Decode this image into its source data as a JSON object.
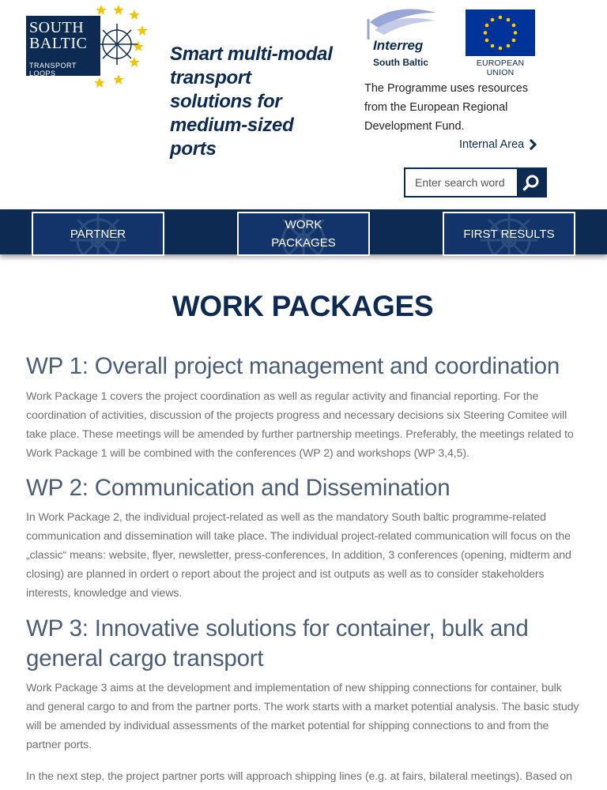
{
  "header": {
    "logo": {
      "line1": "SOUTH",
      "line2": "BALTIC",
      "line3": "TRANSPORT LOOPS"
    },
    "tagline": "Smart multi-modal transport solutions for medium-sized ports",
    "interreg": {
      "word": "Interreg",
      "sub": "South Baltic"
    },
    "eu_label": "EUROPEAN UNION",
    "funding_text": "The Programme uses resources from the European Regional Development Fund.",
    "internal_area": "Internal Area",
    "search": {
      "placeholder": "Enter search word",
      "value": ""
    },
    "brand_color": "#0c2a52"
  },
  "nav": {
    "items": [
      {
        "label": "PARTNER"
      },
      {
        "label": "WORK PACKAGES"
      },
      {
        "label": "FIRST RESULTS"
      }
    ]
  },
  "main": {
    "title": "WORK PACKAGES",
    "sections": [
      {
        "heading": "WP 1: Overall project management and coordination",
        "paragraphs": [
          "Work Package 1 covers the project coordination as well as regular activity and financial reporting. For the coordination of activities, discussion of the projects progress and necessary decisions six Steering Comitee will take place. These meetings will be amended by further partnership meetings. Preferably, the meetings related to Work Package 1 will be combined with the conferences (WP 2) and workshops (WP 3,4,5)."
        ]
      },
      {
        "heading": "WP 2: Communication and Dissemination",
        "paragraphs": [
          "In Work Package 2, the individual project-related as well as the mandatory South baltic programme-related communication and dissemination will take place. The individual project-related communication will focus on the „classic“ means: website, flyer, newsletter, press-conferences, In addition, 3 conferences (opening, midterm and closing) are planned in ordert o report about the project and ist outputs as well as to consider stakeholders interests, knowledge and views."
        ]
      },
      {
        "heading": "WP 3: Innovative solutions for container, bulk and general cargo transport",
        "paragraphs": [
          "Work Package 3 aims at the development and implementation of new shipping connections for container, bulk and general cargo to and from the partner ports. The work starts with a market potential analysis. The basic study will be amended by individual assessments of the market potential for shipping connections to and from the partner ports.",
          "In the next step, the project partner ports will approach shipping lines (e.g. at fairs, bilateral meetings). Based on"
        ]
      }
    ]
  }
}
